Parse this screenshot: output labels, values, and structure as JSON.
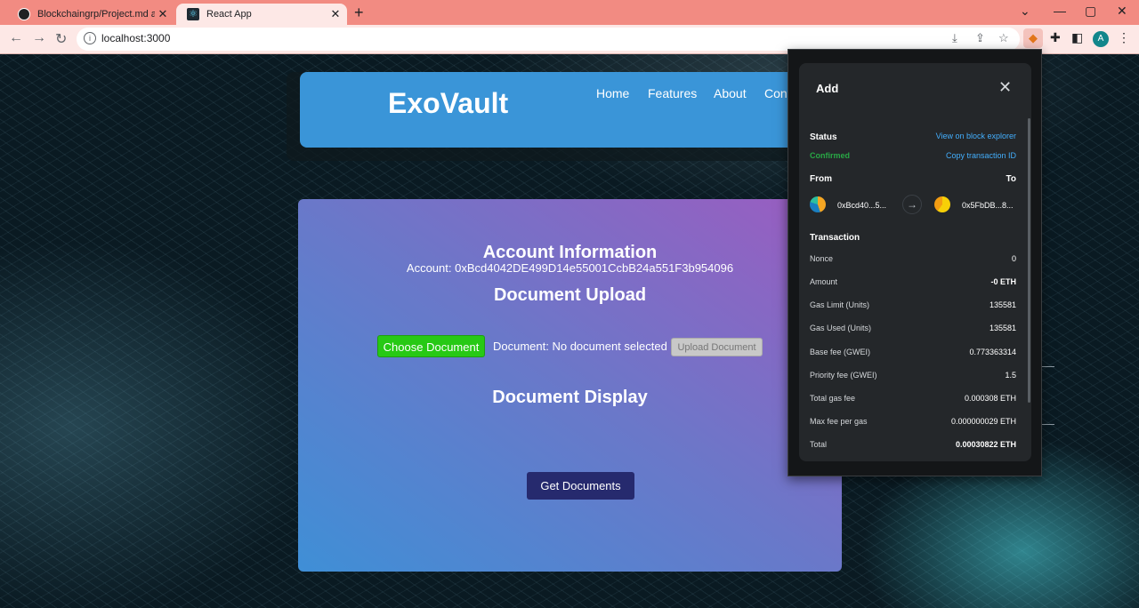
{
  "browser": {
    "tabs": [
      {
        "title": "Blockchaingrp/Project.md at ma",
        "active": false
      },
      {
        "title": "React App",
        "active": true
      }
    ],
    "url": "localhost:3000",
    "profile_initial": "A"
  },
  "header": {
    "logo": "ExoVault",
    "nav": [
      "Home",
      "Features",
      "About",
      "Cont"
    ]
  },
  "main": {
    "account_heading": "Account Information",
    "account_text": "Account: 0xBcd4042DE499D14e55001CcbB24a551F3b954096",
    "upload_heading": "Document Upload",
    "choose_button": "Choose Document",
    "document_status": "Document: No document selected",
    "upload_button": "Upload Document",
    "display_heading": "Document Display",
    "get_button": "Get Documents"
  },
  "popup": {
    "title": "Add",
    "status_label": "Status",
    "status_value": "Confirmed",
    "explorer_link": "View on block explorer",
    "copy_link": "Copy transaction ID",
    "from_label": "From",
    "to_label": "To",
    "from_address": "0xBcd40...5...",
    "to_address": "0x5FbDB...8...",
    "transaction_label": "Transaction",
    "rows": [
      {
        "key": "Nonce",
        "value": "0",
        "bold": false
      },
      {
        "key": "Amount",
        "value": "-0 ETH",
        "bold": true
      },
      {
        "key": "Gas Limit (Units)",
        "value": "135581",
        "bold": false
      },
      {
        "key": "Gas Used (Units)",
        "value": "135581",
        "bold": false
      },
      {
        "key": "Base fee (GWEI)",
        "value": "0.773363314",
        "bold": false
      },
      {
        "key": "Priority fee (GWEI)",
        "value": "1.5",
        "bold": false
      },
      {
        "key": "Total gas fee",
        "value": "0.000308 ETH",
        "bold": false
      },
      {
        "key": "Max fee per gas",
        "value": "0.000000029 ETH",
        "bold": false
      },
      {
        "key": "Total",
        "value": "0.00030822 ETH",
        "bold": true
      }
    ]
  },
  "colors": {
    "tabbar": "#f28b82",
    "header": "#3a95d8",
    "choose_button": "#27c915",
    "get_button": "#262a6e",
    "confirmed": "#28a745",
    "link": "#43aefc"
  }
}
